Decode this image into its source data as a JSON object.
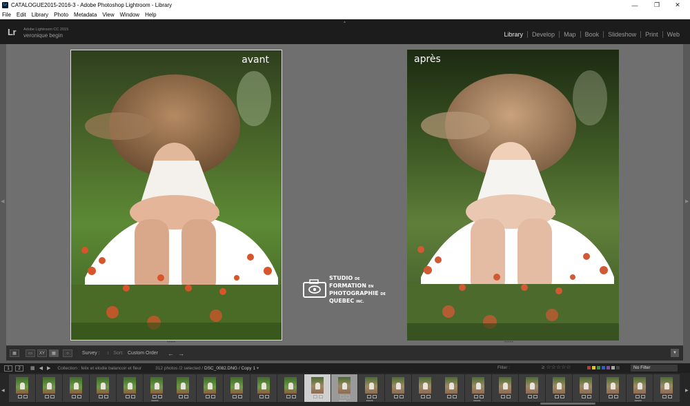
{
  "window": {
    "title": "CATALOGUE2015-2016-3 - Adobe Photoshop Lightroom - Library",
    "icon": "Lr",
    "controls": [
      "minimize",
      "maximize",
      "close"
    ]
  },
  "menu": [
    "File",
    "Edit",
    "Library",
    "Photo",
    "Metadata",
    "View",
    "Window",
    "Help"
  ],
  "header": {
    "logo": "Lr",
    "version": "Adobe Lightroom CC 2015",
    "user": "veronique begin",
    "modules": [
      {
        "label": "Library",
        "active": true
      },
      {
        "label": "Develop",
        "active": false
      },
      {
        "label": "Map",
        "active": false
      },
      {
        "label": "Book",
        "active": false
      },
      {
        "label": "Slideshow",
        "active": false
      },
      {
        "label": "Print",
        "active": false
      },
      {
        "label": "Web",
        "active": false
      }
    ]
  },
  "compare": {
    "before_label": "avant",
    "after_label": "après"
  },
  "watermark": {
    "line1": "STUDIO",
    "line1_small": "DE",
    "line2": "FORMATION",
    "line2_small": "EN",
    "line3": "PHOTOGRAPHIE",
    "line3_small": "DE",
    "line4": "QUEBEC",
    "line4_small": "INC."
  },
  "toolbar": {
    "survey_label": "Survey :",
    "sort_label": "Sort:",
    "sort_value": "Custom Order"
  },
  "filmstrip_bar": {
    "page1": "1",
    "page2": "2",
    "collection": "Collection : felix et elodie balancoir et fleur",
    "count": "312 photos /2 selected /",
    "filename": "DSC_0082.DNG / Copy 1",
    "filter_label": "Filter :",
    "filter_value": "No Filter",
    "swatch_colors": [
      "#c0392b",
      "#e6c229",
      "#2e9e3a",
      "#2f5fc4",
      "#8e44ad",
      "#aaaaaa",
      "#444444"
    ]
  },
  "filmstrip": {
    "thumbnails": [
      {
        "warm": false,
        "state": "normal",
        "dots": ""
      },
      {
        "warm": false,
        "state": "normal",
        "dots": ""
      },
      {
        "warm": false,
        "state": "normal",
        "dots": ""
      },
      {
        "warm": false,
        "state": "normal",
        "dots": ""
      },
      {
        "warm": false,
        "state": "normal",
        "dots": ""
      },
      {
        "warm": false,
        "state": "normal",
        "dots": "•••••"
      },
      {
        "warm": false,
        "state": "normal",
        "dots": ""
      },
      {
        "warm": false,
        "state": "normal",
        "dots": ""
      },
      {
        "warm": false,
        "state": "normal",
        "dots": ""
      },
      {
        "warm": false,
        "state": "normal",
        "dots": ""
      },
      {
        "warm": false,
        "state": "normal",
        "dots": ""
      },
      {
        "warm": true,
        "state": "selected",
        "dots": "•••••"
      },
      {
        "warm": true,
        "state": "selected2",
        "dots": "•••••"
      },
      {
        "warm": true,
        "state": "normal",
        "dots": "•••••"
      },
      {
        "warm": true,
        "state": "normal",
        "dots": ""
      },
      {
        "warm": true,
        "state": "normal",
        "dots": ""
      },
      {
        "warm": true,
        "state": "normal",
        "dots": ""
      },
      {
        "warm": true,
        "state": "normal",
        "dots": "•••••"
      },
      {
        "warm": true,
        "state": "normal",
        "dots": ""
      },
      {
        "warm": true,
        "state": "normal",
        "dots": ""
      },
      {
        "warm": true,
        "state": "normal",
        "dots": ""
      },
      {
        "warm": true,
        "state": "normal",
        "dots": ""
      },
      {
        "warm": true,
        "state": "normal",
        "dots": ""
      },
      {
        "warm": true,
        "state": "normal",
        "dots": "•••••"
      },
      {
        "warm": true,
        "state": "normal",
        "dots": ""
      }
    ]
  }
}
